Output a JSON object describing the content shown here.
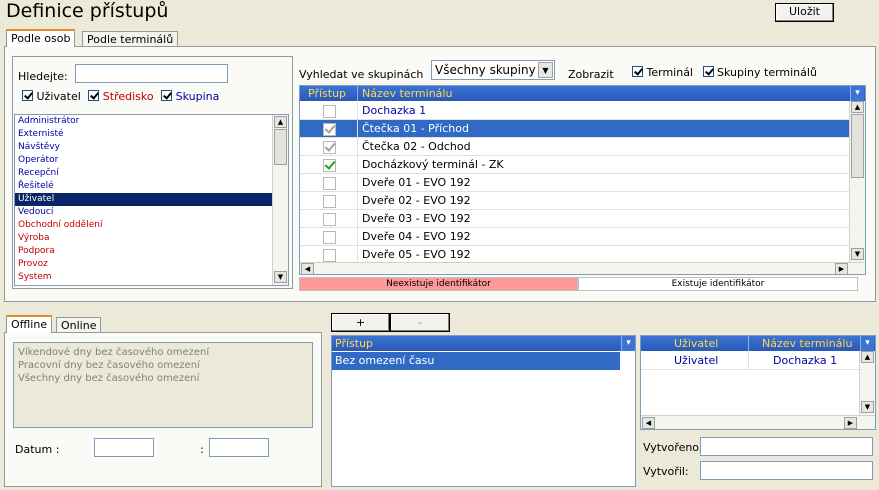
{
  "page": {
    "title": "Definice přístupů",
    "save_label": "Uložit"
  },
  "top_tabs": [
    "Podle osob",
    "Podle terminálů"
  ],
  "search": {
    "label": "Hledejte:",
    "value": ""
  },
  "filters": [
    {
      "label": "Uživatel",
      "checked": true,
      "color": "#000000"
    },
    {
      "label": "Středisko",
      "checked": true,
      "color": "#C00000"
    },
    {
      "label": "Skupina",
      "checked": true,
      "color": "#0000A0"
    }
  ],
  "people_list": [
    {
      "label": "Administrátor",
      "kind": "blue"
    },
    {
      "label": "Externisté",
      "kind": "blue"
    },
    {
      "label": "Návštěvy",
      "kind": "blue"
    },
    {
      "label": "Operátor",
      "kind": "blue"
    },
    {
      "label": "Recepční",
      "kind": "blue"
    },
    {
      "label": "Řešitelé",
      "kind": "blue"
    },
    {
      "label": "Uživatel",
      "kind": "selected"
    },
    {
      "label": "Vedoucí",
      "kind": "blue"
    },
    {
      "label": "Obchodní oddělení",
      "kind": "red"
    },
    {
      "label": "Výroba",
      "kind": "red"
    },
    {
      "label": "Podpora",
      "kind": "red"
    },
    {
      "label": "Provoz",
      "kind": "red"
    },
    {
      "label": "System",
      "kind": "red"
    }
  ],
  "group_search": {
    "label": "Vyhledat ve skupinách",
    "selected": "Všechny skupiny"
  },
  "show": {
    "label": "Zobrazit",
    "options": [
      {
        "label": "Terminál",
        "checked": true
      },
      {
        "label": "Skupiny terminálů",
        "checked": true
      }
    ]
  },
  "terminal_grid": {
    "headers": [
      "Přístup",
      "Název terminálu"
    ],
    "rows": [
      {
        "name": "Dochazka 1",
        "access": "none",
        "color": "#0000A0"
      },
      {
        "name": "Čtečka 01 - Příchod",
        "access": "gray",
        "selected": true
      },
      {
        "name": "Čtečka 02 - Odchod",
        "access": "gray"
      },
      {
        "name": "Docházkový terminál - ZK",
        "access": "checked"
      },
      {
        "name": "Dveře 01 - EVO 192",
        "access": "none"
      },
      {
        "name": "Dveře 02 - EVO 192",
        "access": "none"
      },
      {
        "name": "Dveře 03 - EVO 192",
        "access": "none"
      },
      {
        "name": "Dveře 04 - EVO 192",
        "access": "none"
      },
      {
        "name": "Dveře 05 - EVO 192",
        "access": "none"
      }
    ]
  },
  "legend": {
    "missing": "Neexistuje identifikátor",
    "exists": "Existuje identifikátor",
    "missing_color": "#FF9999"
  },
  "bottom_tabs": [
    "Offline",
    "Online"
  ],
  "schedules": [
    "Víkendové dny bez časového omezení",
    "Pracovní dny bez časového omezení",
    "Všechny dny bez časového omezení"
  ],
  "date": {
    "label": "Datum :",
    "sep": ":",
    "from": "",
    "to": ""
  },
  "access_buttons": {
    "add": "+",
    "remove": "-"
  },
  "access_grid": {
    "header": "Přístup",
    "rows": [
      "Bez omezení času"
    ]
  },
  "assign_grid": {
    "headers": [
      "Uživatel",
      "Název terminálu"
    ],
    "rows": [
      {
        "user": "Uživatel",
        "terminal": "Dochazka 1"
      }
    ]
  },
  "meta": {
    "created_label": "Vytvořeno:",
    "created_by_label": "Vytvořil:",
    "created": "",
    "created_by": ""
  }
}
